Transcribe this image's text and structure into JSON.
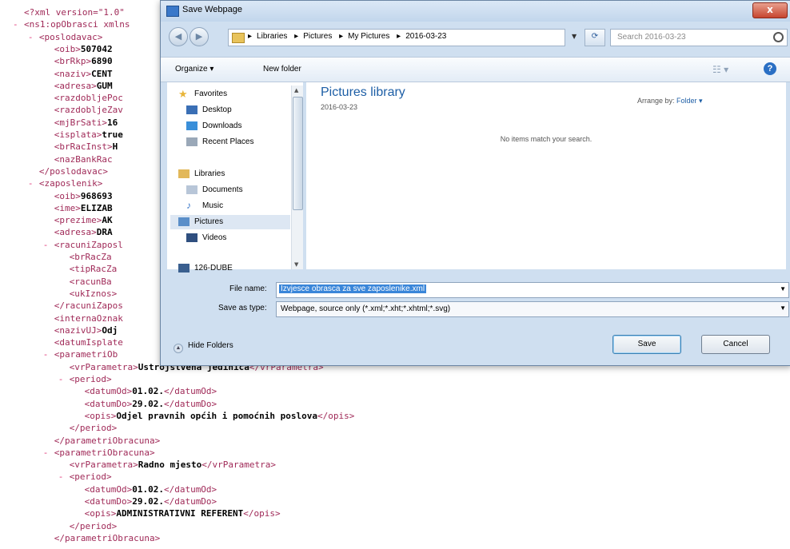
{
  "xml": {
    "lines": [
      {
        "indent": 0,
        "mn": "",
        "tag": "<?xml version=\"1.0\"",
        "txt": "",
        "close": ""
      },
      {
        "indent": 0,
        "mn": "-",
        "tag": "<ns1:opObrasci xmlns",
        "txt": "",
        "close": ""
      },
      {
        "indent": 2,
        "mn": "-",
        "tag": "<poslodavac>",
        "txt": "",
        "close": ""
      },
      {
        "indent": 4,
        "mn": "",
        "tag": "<oib>",
        "txt": "507042",
        "close": ""
      },
      {
        "indent": 4,
        "mn": "",
        "tag": "<brRkp>",
        "txt": "6890",
        "close": ""
      },
      {
        "indent": 4,
        "mn": "",
        "tag": "<naziv>",
        "txt": "CENT",
        "close": ""
      },
      {
        "indent": 4,
        "mn": "",
        "tag": "<adresa>",
        "txt": "GUM",
        "close": ""
      },
      {
        "indent": 4,
        "mn": "",
        "tag": "<razdobljePoc",
        "txt": "",
        "close": ""
      },
      {
        "indent": 4,
        "mn": "",
        "tag": "<razdobljeZav",
        "txt": "",
        "close": ""
      },
      {
        "indent": 4,
        "mn": "",
        "tag": "<mjBrSati>",
        "txt": "16",
        "close": ""
      },
      {
        "indent": 4,
        "mn": "",
        "tag": "<isplata>",
        "txt": "true",
        "close": ""
      },
      {
        "indent": 4,
        "mn": "",
        "tag": "<brRacInst>",
        "txt": "H",
        "close": ""
      },
      {
        "indent": 4,
        "mn": "",
        "tag": "<nazBankRac",
        "txt": "",
        "close": ""
      },
      {
        "indent": 2,
        "mn": "",
        "tag": "</poslodavac>",
        "txt": "",
        "close": ""
      },
      {
        "indent": 2,
        "mn": "-",
        "tag": "<zaposlenik>",
        "txt": "",
        "close": ""
      },
      {
        "indent": 4,
        "mn": "",
        "tag": "<oib>",
        "txt": "968693",
        "close": ""
      },
      {
        "indent": 4,
        "mn": "",
        "tag": "<ime>",
        "txt": "ELIZAB",
        "close": ""
      },
      {
        "indent": 4,
        "mn": "",
        "tag": "<prezime>",
        "txt": "AK",
        "close": ""
      },
      {
        "indent": 4,
        "mn": "",
        "tag": "<adresa>",
        "txt": "DRA",
        "close": ""
      },
      {
        "indent": 4,
        "mn": "-",
        "tag": "<racuniZaposl",
        "txt": "",
        "close": ""
      },
      {
        "indent": 6,
        "mn": "",
        "tag": "<brRacZa",
        "txt": "",
        "close": ""
      },
      {
        "indent": 6,
        "mn": "",
        "tag": "<tipRacZa",
        "txt": "",
        "close": ""
      },
      {
        "indent": 6,
        "mn": "",
        "tag": "<racunBa",
        "txt": "",
        "close": ""
      },
      {
        "indent": 6,
        "mn": "",
        "tag": "<ukIznos>",
        "txt": "",
        "close": ""
      },
      {
        "indent": 4,
        "mn": "",
        "tag": "</racuniZapos",
        "txt": "",
        "close": ""
      },
      {
        "indent": 4,
        "mn": "",
        "tag": "<internaOznak",
        "txt": "",
        "close": ""
      },
      {
        "indent": 4,
        "mn": "",
        "tag": "<nazivUJ>",
        "txt": "Odj",
        "close": ""
      },
      {
        "indent": 4,
        "mn": "",
        "tag": "<datumIsplate",
        "txt": "",
        "close": ""
      },
      {
        "indent": 4,
        "mn": "-",
        "tag": "<parametriOb",
        "txt": "",
        "close": ""
      },
      {
        "indent": 6,
        "mn": "",
        "tag": "<vrParametra>",
        "txt": "Ustrojstvena jedinica",
        "close": "</vrParametra>"
      },
      {
        "indent": 6,
        "mn": "-",
        "tag": "<period>",
        "txt": "",
        "close": ""
      },
      {
        "indent": 8,
        "mn": "",
        "tag": "<datumOd>",
        "txt": "01.02.",
        "close": "</datumOd>"
      },
      {
        "indent": 8,
        "mn": "",
        "tag": "<datumDo>",
        "txt": "29.02.",
        "close": "</datumDo>"
      },
      {
        "indent": 8,
        "mn": "",
        "tag": "<opis>",
        "txt": "Odjel pravnih općih i pomoćnih poslova",
        "close": "</opis>"
      },
      {
        "indent": 6,
        "mn": "",
        "tag": "</period>",
        "txt": "",
        "close": ""
      },
      {
        "indent": 4,
        "mn": "",
        "tag": "</parametriObracuna>",
        "txt": "",
        "close": ""
      },
      {
        "indent": 4,
        "mn": "-",
        "tag": "<parametriObracuna>",
        "txt": "",
        "close": ""
      },
      {
        "indent": 6,
        "mn": "",
        "tag": "<vrParametra>",
        "txt": "Radno mjesto",
        "close": "</vrParametra>"
      },
      {
        "indent": 6,
        "mn": "-",
        "tag": "<period>",
        "txt": "",
        "close": ""
      },
      {
        "indent": 8,
        "mn": "",
        "tag": "<datumOd>",
        "txt": "01.02.",
        "close": "</datumOd>"
      },
      {
        "indent": 8,
        "mn": "",
        "tag": "<datumDo>",
        "txt": "29.02.",
        "close": "</datumDo>"
      },
      {
        "indent": 8,
        "mn": "",
        "tag": "<opis>",
        "txt": "ADMINISTRATIVNI REFERENT",
        "close": "</opis>"
      },
      {
        "indent": 6,
        "mn": "",
        "tag": "</period>",
        "txt": "",
        "close": ""
      },
      {
        "indent": 4,
        "mn": "",
        "tag": "</parametriObracuna>",
        "txt": "",
        "close": ""
      }
    ]
  },
  "dialog": {
    "title": "Save Webpage",
    "close_label": "x",
    "breadcrumbs": [
      "Libraries",
      "Pictures",
      "My Pictures",
      "2016-03-23"
    ],
    "search_placeholder": "Search 2016-03-23",
    "organize": "Organize ▾",
    "new_folder": "New folder",
    "nav": [
      {
        "label": "Favorites",
        "icon": "star-icon",
        "color": "#e8b53a"
      },
      {
        "label": "Desktop",
        "icon": "desktop-icon",
        "color": "#3a6fb5"
      },
      {
        "label": "Downloads",
        "icon": "downloads-icon",
        "color": "#3a8fd9"
      },
      {
        "label": "Recent Places",
        "icon": "recent-places-icon",
        "color": "#9aa8b8"
      },
      {
        "label": "Libraries",
        "icon": "libraries-icon",
        "color": "#e2b85a"
      },
      {
        "label": "Documents",
        "icon": "documents-icon",
        "color": "#b8c6d8"
      },
      {
        "label": "Music",
        "icon": "music-icon",
        "color": "#3a78c9"
      },
      {
        "label": "Pictures",
        "icon": "pictures-icon",
        "color": "#5b8fc9"
      },
      {
        "label": "Videos",
        "icon": "videos-icon",
        "color": "#2f4f7f"
      },
      {
        "label": "126-DUBE",
        "icon": "computer-icon",
        "color": "#3a5f8f"
      }
    ],
    "library_title": "Pictures library",
    "library_sub": "2016-03-23",
    "arrange_by": "Arrange by:",
    "arrange_value": "Folder ▾",
    "empty_message": "No items match your search.",
    "file_name_label": "File name:",
    "file_name_value": "Izvjesce obrasca za sve zaposlenike.xml",
    "save_type_label": "Save as type:",
    "save_type_value": "Webpage, source only (*.xml;*.xht;*.xhtml;*.svg)",
    "hide_folders": "Hide Folders",
    "save_label": "Save",
    "cancel_label": "Cancel"
  }
}
